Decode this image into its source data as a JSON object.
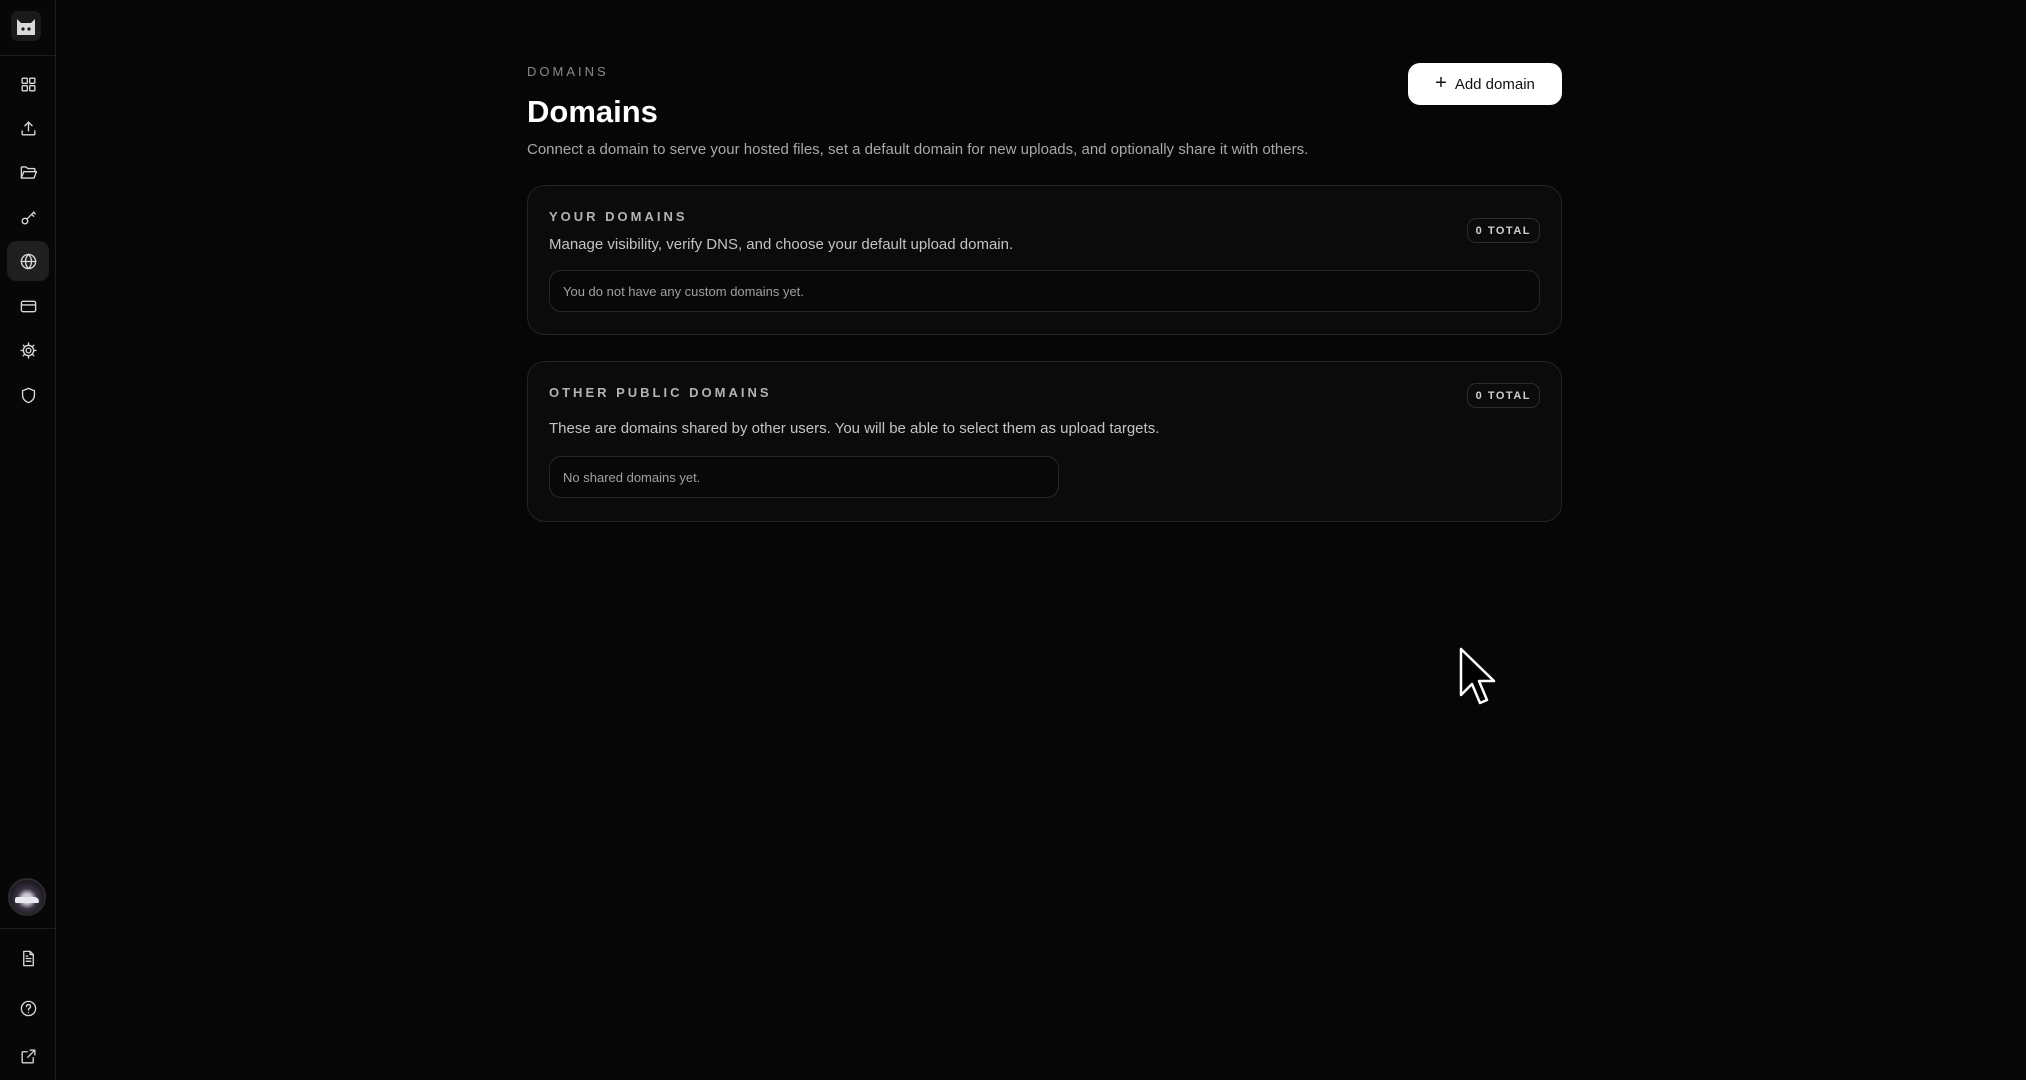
{
  "sidebar": {
    "logo": "cat-logo-icon",
    "items": [
      {
        "icon": "dashboard-grid-icon",
        "active": false
      },
      {
        "icon": "upload-icon",
        "active": false
      },
      {
        "icon": "folder-icon",
        "active": false
      },
      {
        "icon": "key-icon",
        "active": false
      },
      {
        "icon": "globe-icon",
        "active": true
      },
      {
        "icon": "credit-card-icon",
        "active": false
      },
      {
        "icon": "gear-icon",
        "active": false
      },
      {
        "icon": "shield-icon",
        "active": false
      }
    ],
    "bottom_items": [
      {
        "icon": "document-icon"
      },
      {
        "icon": "help-circle-icon"
      },
      {
        "icon": "external-link-icon"
      }
    ]
  },
  "header": {
    "eyebrow": "DOMAINS",
    "title": "Domains",
    "description": "Connect a domain to serve your hosted files, set a default domain for new uploads, and optionally share it with others.",
    "add_button_label": "Add domain"
  },
  "your_domains": {
    "title": "YOUR DOMAINS",
    "description": "Manage visibility, verify DNS, and choose your default upload domain.",
    "badge": "0 TOTAL",
    "empty_text": "You do not have any custom domains yet."
  },
  "public_domains": {
    "title": "OTHER PUBLIC DOMAINS",
    "description": "These are domains shared by other users. You will be able to select them as upload targets.",
    "badge": "0 TOTAL",
    "empty_text": "No shared domains yet."
  },
  "colors": {
    "background": "#060606",
    "card_border": "#232323",
    "primary_button": "#ffffff"
  }
}
